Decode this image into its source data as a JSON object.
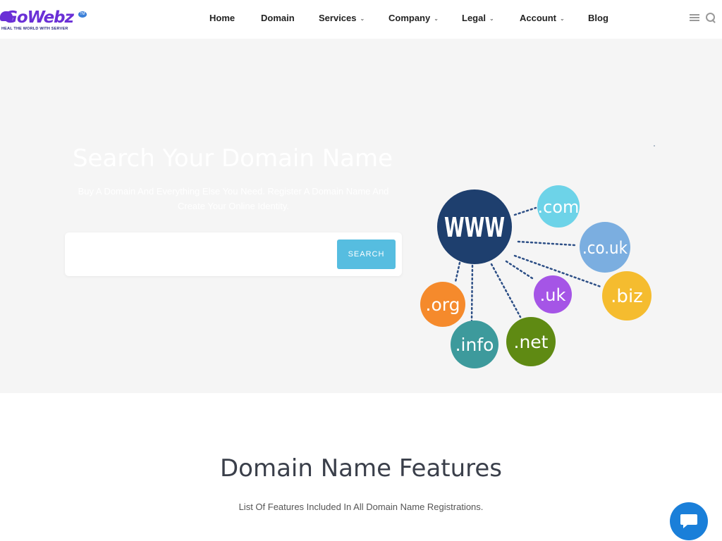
{
  "logo": {
    "text": "GoWebz",
    "tagline": "HEAL THE WORLD WITH SERVER",
    "tm": "TM"
  },
  "nav": {
    "items": [
      {
        "label": "Home",
        "has_dropdown": false
      },
      {
        "label": "Domain",
        "has_dropdown": false
      },
      {
        "label": "Services",
        "has_dropdown": true
      },
      {
        "label": "Company",
        "has_dropdown": true
      },
      {
        "label": "Legal",
        "has_dropdown": true
      },
      {
        "label": "Account",
        "has_dropdown": true
      },
      {
        "label": "Blog",
        "has_dropdown": false
      }
    ],
    "icons": [
      "menu-icon",
      "search-icon"
    ]
  },
  "hero": {
    "title": "Search Your Domain Name",
    "subtitle_line1": "Buy A Domain And Everything Else You Need. Register A Domain Name And",
    "subtitle_line2": "Create Your Online Identity.",
    "search": {
      "value": "",
      "placeholder": "",
      "button_label": "SEARCH"
    },
    "graphic": {
      "center": {
        "label": "WWW",
        "color": "#1e3f6e"
      },
      "tlds": [
        {
          "label": ".com",
          "color": "#6dd3e8"
        },
        {
          "label": ".co.uk",
          "color": "#7baee0"
        },
        {
          "label": ".biz",
          "color": "#f5bc2f"
        },
        {
          "label": ".uk",
          "color": "#a555e6"
        },
        {
          "label": ".net",
          "color": "#5f8a13"
        },
        {
          "label": ".info",
          "color": "#3d9a9c"
        },
        {
          "label": ".org",
          "color": "#f58a2c"
        }
      ]
    }
  },
  "features": {
    "title": "Domain Name Features",
    "subtitle": "List Of Features Included In All Domain Name Registrations."
  },
  "colors": {
    "accent": "#56bde0",
    "brand": "#6a2fd6",
    "chat": "#1a7fd9",
    "hero_bg": "#f5f5f5"
  },
  "chat": {
    "icon": "chat-bubble-icon"
  }
}
